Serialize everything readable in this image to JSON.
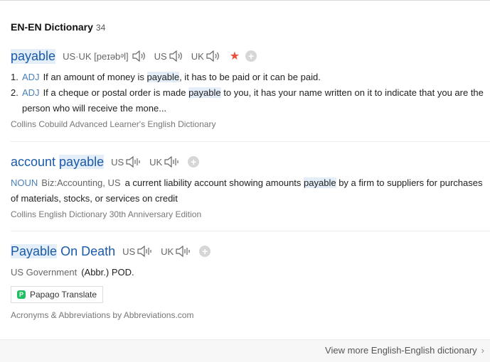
{
  "header": {
    "title": "EN-EN Dictionary",
    "count": "34"
  },
  "entries": [
    {
      "headword": "payable",
      "phonetic": "US·UK [peɪəbᵊl]",
      "us": "US",
      "uk": "UK",
      "defs": [
        {
          "num": "1.",
          "pos": "ADJ",
          "pre": "If an amount of money is ",
          "hl": "payable",
          "post": ", it has to be paid or it can be paid."
        },
        {
          "num": "2.",
          "pos": "ADJ",
          "pre": "If a cheque or postal order is made ",
          "hl": "payable",
          "post": " to you, it has your name written on it to indicate that you are the person who will receive the mone..."
        }
      ],
      "source": "Collins Cobuild Advanced Learner's English Dictionary"
    },
    {
      "headword_part1": "account",
      "headword_part2": "payable",
      "us": "US",
      "uk": "UK",
      "def": {
        "pos": "NOUN",
        "field": "Biz:Accounting, US",
        "pre": "a current liability account showing amounts ",
        "hl": "payable",
        "post": " by a firm to suppliers for purchases of materials, stocks, or services on credit"
      },
      "source": "Collins English Dictionary 30th Anniversary Edition"
    },
    {
      "headword_part1": "Payable",
      "headword_part2": "On Death",
      "us": "US",
      "uk": "UK",
      "def": {
        "field": "US Government",
        "text": "(Abbr.) POD."
      },
      "papago": "Papago Translate",
      "source": "Acronyms & Abbreviations by Abbreviations.com"
    }
  ],
  "footer": {
    "more": "View more English-English dictionary"
  },
  "colors": {
    "headword": "#1a5aa8",
    "highlight": "#e4eef8",
    "star": "#e8503a"
  }
}
